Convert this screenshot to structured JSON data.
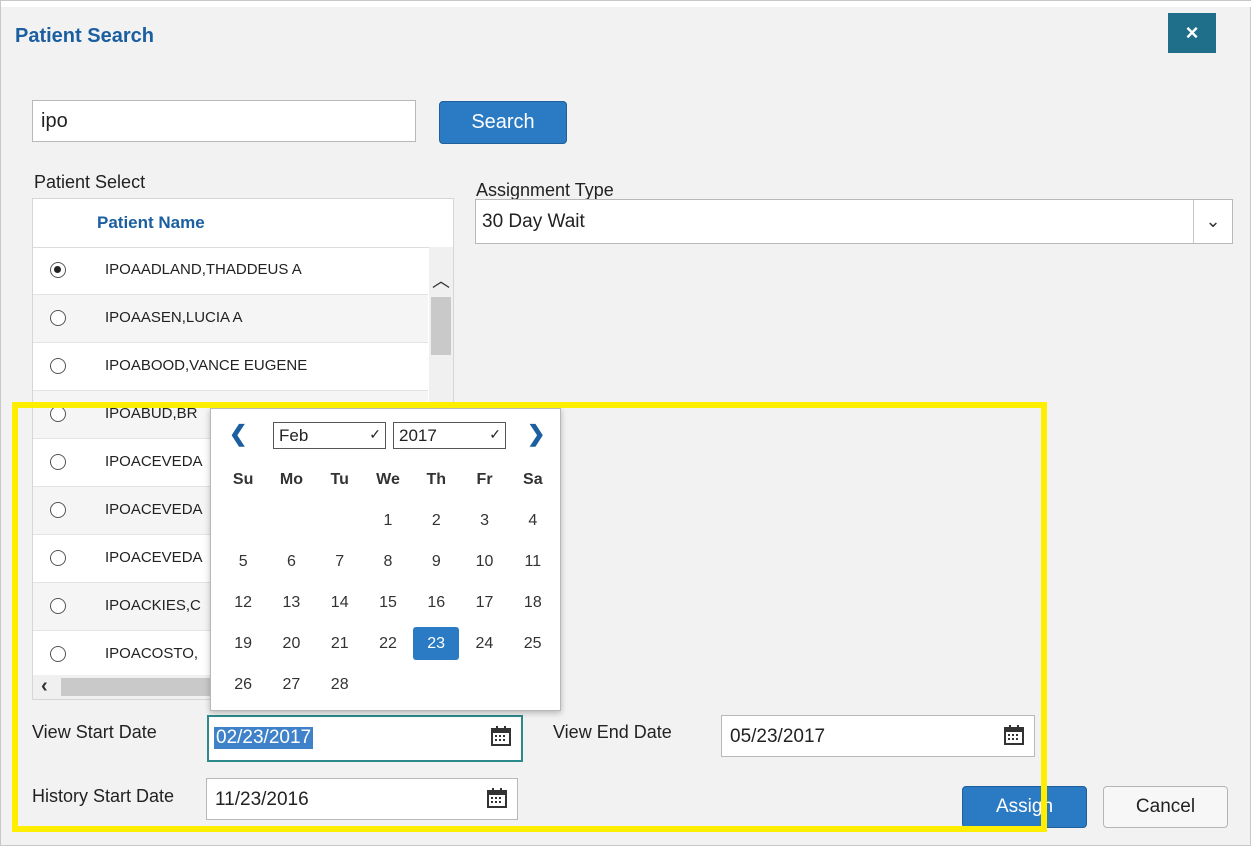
{
  "dialog": {
    "title": "Patient Search",
    "close_label": "×"
  },
  "search": {
    "value": "ipo",
    "button_label": "Search"
  },
  "patient_select": {
    "label": "Patient Select",
    "column_header": "Patient Name",
    "rows": [
      {
        "name": "IPOAADLAND,THADDEUS A",
        "selected": true
      },
      {
        "name": "IPOAASEN,LUCIA A",
        "selected": false
      },
      {
        "name": "IPOABOOD,VANCE EUGENE",
        "selected": false
      },
      {
        "name": "IPOABUD,BR",
        "selected": false
      },
      {
        "name": "IPOACEVEDA",
        "selected": false
      },
      {
        "name": "IPOACEVEDA",
        "selected": false
      },
      {
        "name": "IPOACEVEDA",
        "selected": false
      },
      {
        "name": "IPOACKIES,C",
        "selected": false
      },
      {
        "name": "IPOACOSTO,",
        "selected": false
      }
    ]
  },
  "assignment": {
    "label": "Assignment Type",
    "value": "30 Day Wait"
  },
  "calendar": {
    "month": "Feb",
    "year": "2017",
    "weekdays": [
      "Su",
      "Mo",
      "Tu",
      "We",
      "Th",
      "Fr",
      "Sa"
    ],
    "weeks": [
      [
        "",
        "",
        "",
        "1",
        "2",
        "3",
        "4"
      ],
      [
        "5",
        "6",
        "7",
        "8",
        "9",
        "10",
        "11"
      ],
      [
        "12",
        "13",
        "14",
        "15",
        "16",
        "17",
        "18"
      ],
      [
        "19",
        "20",
        "21",
        "22",
        "23",
        "24",
        "25"
      ],
      [
        "26",
        "27",
        "28",
        "",
        "",
        "",
        ""
      ]
    ],
    "selected_day": "23"
  },
  "dates": {
    "view_start_label": "View Start Date",
    "view_start_value": "02/23/2017",
    "view_end_label": "View End Date",
    "view_end_value": "05/23/2017",
    "history_start_label": "History Start Date",
    "history_start_value": "11/23/2016"
  },
  "actions": {
    "assign_label": "Assign",
    "cancel_label": "Cancel"
  },
  "colors": {
    "accent": "#2b7ac4",
    "title": "#1b5fa0",
    "close": "#1f6f8b",
    "highlight": "#ffee00"
  }
}
